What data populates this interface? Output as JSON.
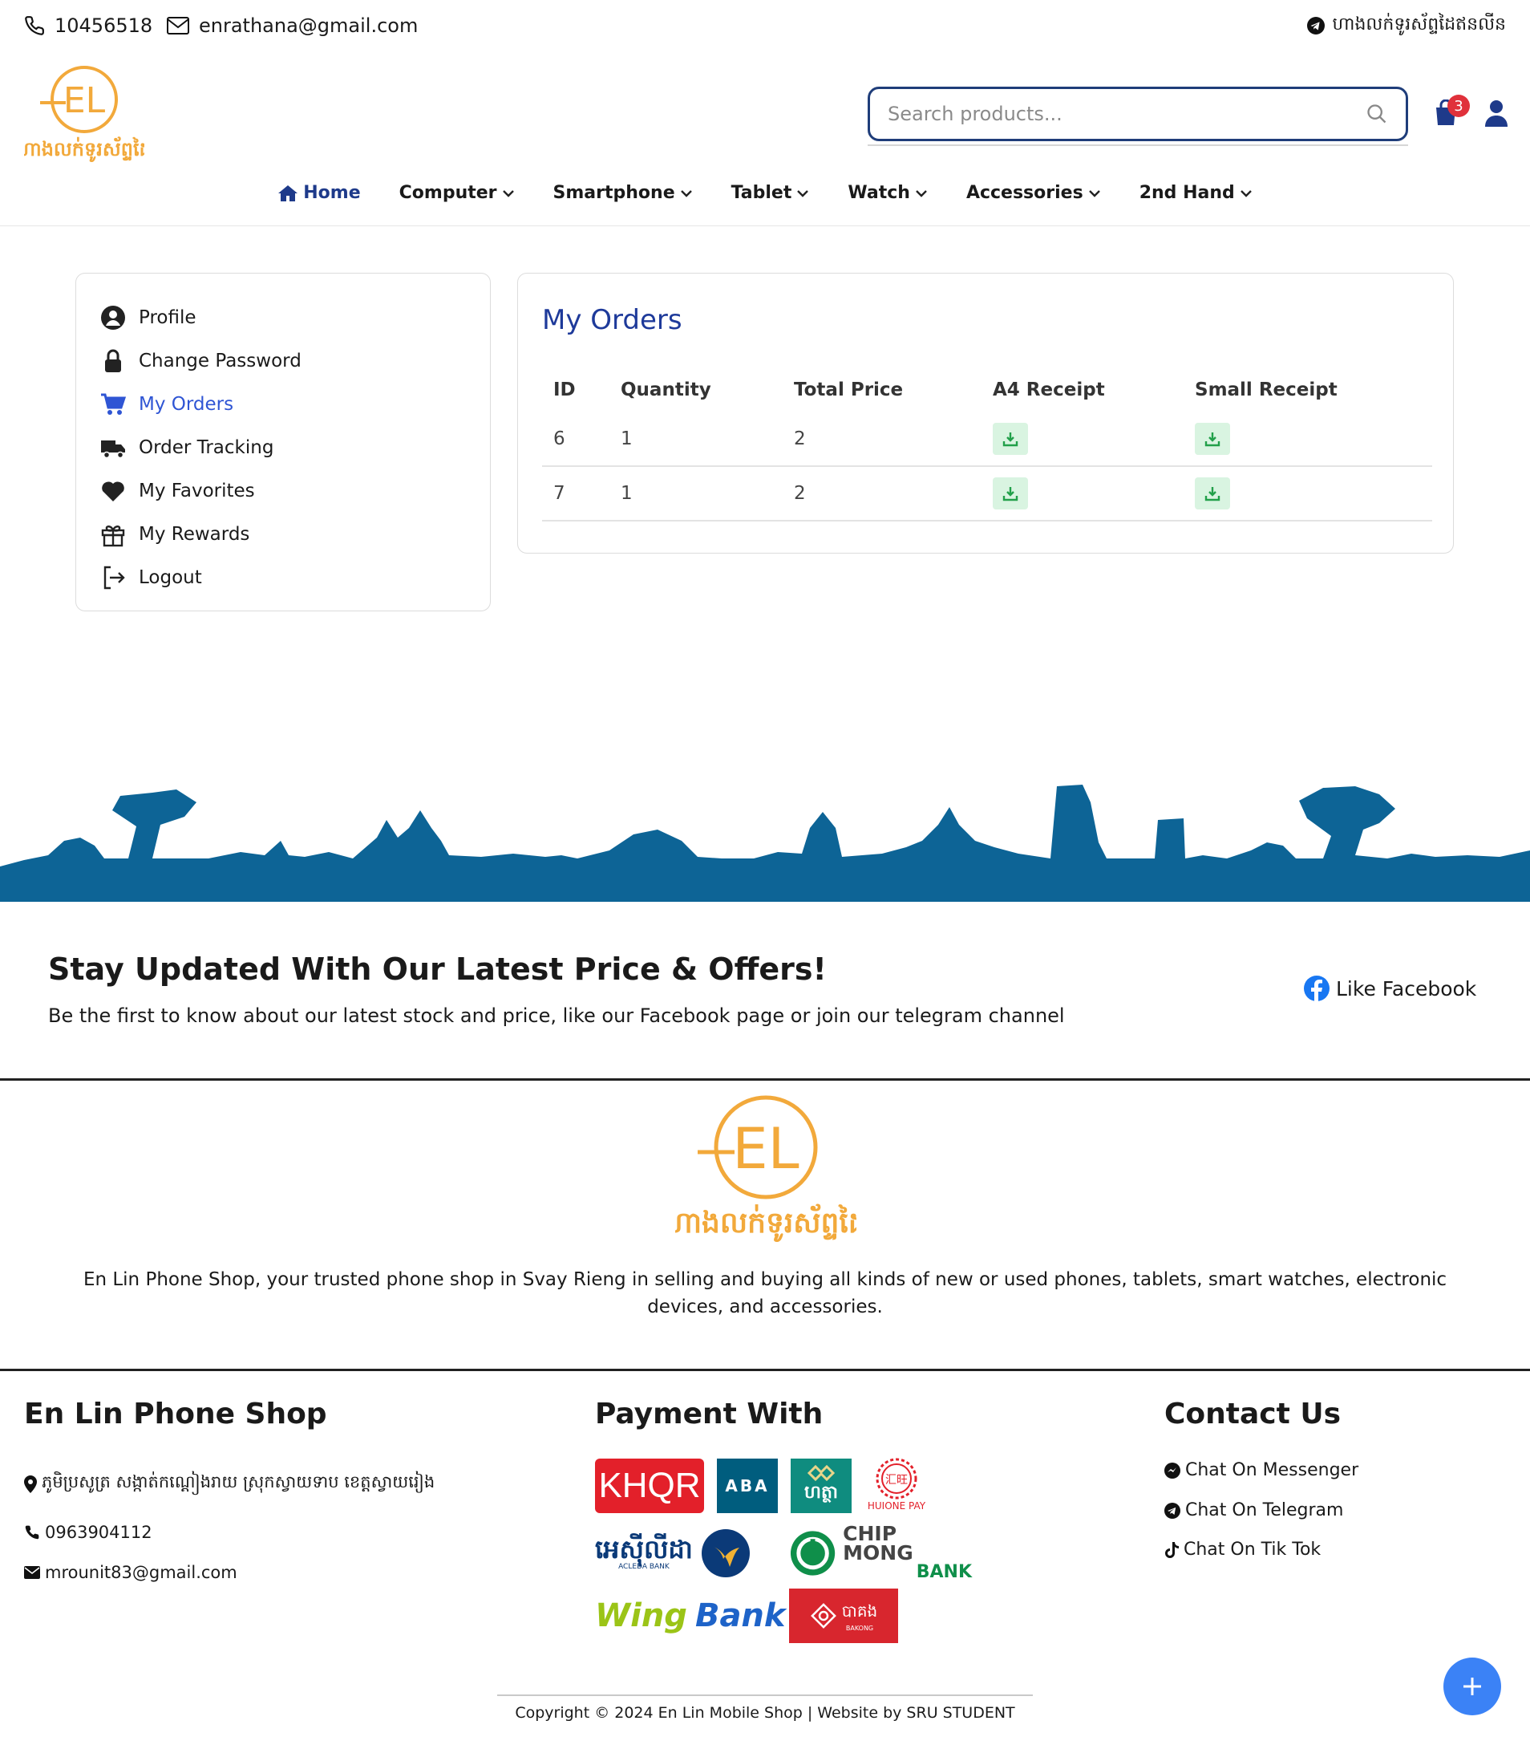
{
  "topbar": {
    "phone": "10456518",
    "email": "enrathana@gmail.com",
    "channel_text": "ហាងលក់ទូរស័ព្ទដៃឥនលីន"
  },
  "logo": {
    "monogram": "EL",
    "khmer_name": "ហាងលក់ទូរស័ព្ទដៃ"
  },
  "search": {
    "placeholder": "Search products..."
  },
  "cart": {
    "count": "3"
  },
  "nav": [
    {
      "label": "Home",
      "icon": "home-icon"
    },
    {
      "label": "Computer"
    },
    {
      "label": "Smartphone"
    },
    {
      "label": "Tablet"
    },
    {
      "label": "Watch"
    },
    {
      "label": "Accessories"
    },
    {
      "label": "2nd Hand"
    }
  ],
  "sidebar": [
    {
      "label": "Profile",
      "icon": "user-circle-icon"
    },
    {
      "label": "Change Password",
      "icon": "lock-icon"
    },
    {
      "label": "My Orders",
      "icon": "cart-icon"
    },
    {
      "label": "Order Tracking",
      "icon": "truck-icon"
    },
    {
      "label": "My Favorites",
      "icon": "heart-icon"
    },
    {
      "label": "My Rewards",
      "icon": "gift-icon"
    },
    {
      "label": "Logout",
      "icon": "logout-icon"
    }
  ],
  "orders": {
    "title": "My Orders",
    "columns": [
      "ID",
      "Quantity",
      "Total Price",
      "A4 Receipt",
      "Small Receipt"
    ],
    "rows": [
      {
        "id": "6",
        "quantity": "1",
        "total": "2"
      },
      {
        "id": "7",
        "quantity": "1",
        "total": "2"
      }
    ]
  },
  "newsletter": {
    "title": "Stay Updated With Our Latest Price & Offers!",
    "text": "Be the first to know about our latest stock and price, like our Facebook page or join our telegram channel",
    "like_label": "Like Facebook"
  },
  "about": "En Lin Phone Shop, your trusted phone shop in Svay Rieng in selling and buying all kinds of new or used phones, tablets, smart watches, electronic devices, and accessories.",
  "shop": {
    "title": "En Lin Phone Shop",
    "address": "ភូមិប្រសូត្រ សង្កាត់កណ្តៀងរាយ ស្រុកស្វាយទាប ខេត្តស្វាយរៀង",
    "phone": "0963904112",
    "email": "mrounit83@gmail.com"
  },
  "payment": {
    "title": "Payment With",
    "khqr": "KHQR",
    "aba": "ABA",
    "hattha": "ហត្ថា",
    "huione": "HUIONE PAY",
    "huione_mark": "汇旺",
    "acleda": "អេស៊ីលីដា",
    "acleda_sub": "ACLEDA BANK",
    "chipmong1": "CHIP MONG",
    "chipmong2": "BANK",
    "wing1": "Wing",
    "wing2": "Bank",
    "bakong": "បាគង",
    "bakong_sub": "BAKONG"
  },
  "contact": {
    "title": "Contact Us",
    "messenger": "Chat On Messenger",
    "telegram": "Chat On Telegram",
    "tiktok": "Chat On Tik Tok"
  },
  "copyright": "Copyright © 2024 En Lin Mobile Shop | Website by SRU STUDENT",
  "colors": {
    "brand_blue": "#1e3a8a",
    "accent_orange": "#f2a93b",
    "skyline": "#0d6496",
    "active_link": "#2f55d4"
  }
}
